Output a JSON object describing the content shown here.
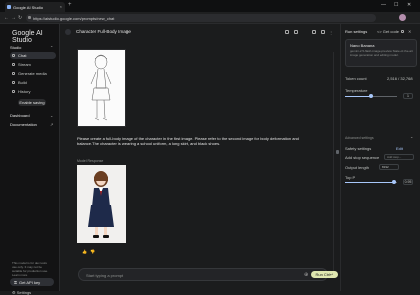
{
  "browser": {
    "tab_title": "Google AI Studio",
    "tab_close": "×",
    "new_tab": "+",
    "url": "https://aistudio.google.com/prompts/new_chat",
    "win_min": "—",
    "win_max": "☐",
    "win_close": "✕",
    "back": "←",
    "forward": "→",
    "reload": "↻"
  },
  "sidebar": {
    "logo": "Google AI Studio",
    "studio_label": "Studio",
    "items": [
      {
        "label": "Chat"
      },
      {
        "label": "Stream"
      },
      {
        "label": "Generate media"
      },
      {
        "label": "Build"
      },
      {
        "label": "History"
      }
    ],
    "enable_saving": "Enable saving",
    "dashboard_label": "Dashboard",
    "documentation_label": "Documentation",
    "note": "This model is for dev tools use only. It may not be suitable for production use. Learn more",
    "get_api_key": "Get API key",
    "settings": "Settings"
  },
  "main": {
    "title": "Character Full-Body Image",
    "prompt": "Please create a full-body image of the character in the first image. Please refer to the second image for body deformation and balance.The character is wearing a school uniform, a long skirt, and black shoes.",
    "model_label": "Model Response",
    "composer_placeholder": "Start typing a prompt",
    "run_label": "Run Ctrl↵"
  },
  "panel": {
    "title": "Run settings",
    "get_code": "Get code",
    "model_name": "Nano Banana",
    "model_desc": "gemini-2.5-flash-image-preview State-of-the-art image generation and editing model.",
    "token_count_label": "Token count",
    "token_count_value": "2,516 / 32,768",
    "temperature_label": "Temperature",
    "temperature_value": 1,
    "advanced_label": "Advanced settings",
    "safety_label": "Safety settings",
    "safety_action": "Edit",
    "stop_label": "Add stop sequence",
    "stop_placeholder": "Add stop...",
    "output_length_label": "Output length",
    "output_length_value": "8192",
    "top_p_label": "Top P",
    "top_p_value": 0.95
  }
}
